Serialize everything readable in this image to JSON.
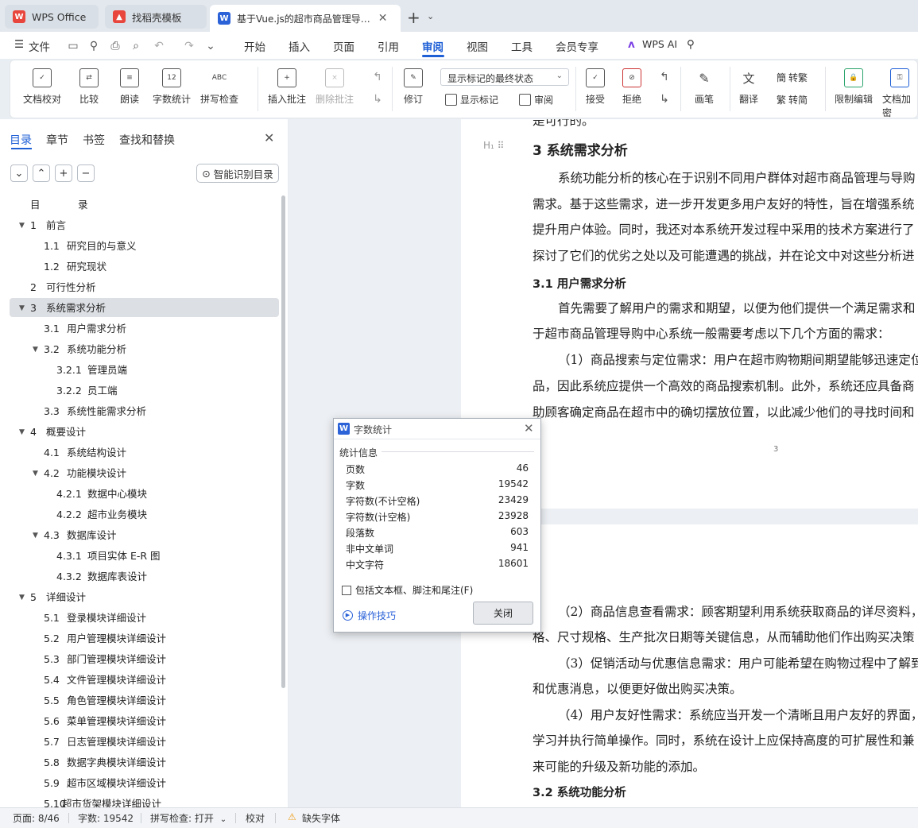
{
  "tabs": [
    {
      "label": "WPS Office",
      "icon": "wps-office-icon",
      "color": "#e8453c"
    },
    {
      "label": "找稻壳模板",
      "icon": "docer-template-icon",
      "color": "#e8453c"
    },
    {
      "label": "基于Vue.js的超市商品管理导…",
      "icon": "wps-writer-icon",
      "color": "#2b62d8"
    }
  ],
  "menubar": {
    "file": "文件",
    "items": [
      "开始",
      "插入",
      "页面",
      "引用",
      "审阅",
      "视图",
      "工具",
      "会员专享"
    ],
    "active": "审阅",
    "wps_ai": "WPS AI"
  },
  "ribbon": {
    "doc_proof": "文档校对",
    "compare": "比较",
    "read_aloud": "朗读",
    "word_count": "字数统计",
    "spell_check": "拼写检查",
    "insert_comment": "插入批注",
    "delete_comment": "删除批注",
    "revise": "修订",
    "display_dropdown": "显示标记的最终状态",
    "show_markup": "显示标记",
    "review": "审阅",
    "accept": "接受",
    "reject": "拒绝",
    "pen": "画笔",
    "translate": "翻译",
    "to_traditional": "转繁",
    "to_simplified": "转简",
    "restrict_edit": "限制编辑",
    "doc_encrypt": "文档加密",
    "word_count_icon_text": "12",
    "spell_icon_text": "ABC"
  },
  "leftpanel": {
    "tabs": [
      "目录",
      "章节",
      "书签",
      "查找和替换"
    ],
    "active_tab": "目录",
    "smart_button": "智能识别目录",
    "toc": [
      {
        "num": "目",
        "title": "录",
        "level": 0,
        "toggle": "",
        "highlight": false
      },
      {
        "num": "1",
        "title": "前言",
        "level": 1,
        "toggle": "▼",
        "highlight": false
      },
      {
        "num": "1.1",
        "title": "研究目的与意义",
        "level": 2,
        "toggle": "",
        "highlight": false
      },
      {
        "num": "1.2",
        "title": "研究现状",
        "level": 2,
        "toggle": "",
        "highlight": false
      },
      {
        "num": "2",
        "title": "可行性分析",
        "level": 1,
        "toggle": "",
        "highlight": false
      },
      {
        "num": "3",
        "title": "系统需求分析",
        "level": 1,
        "toggle": "▼",
        "highlight": true
      },
      {
        "num": "3.1",
        "title": "用户需求分析",
        "level": 2,
        "toggle": "",
        "highlight": false
      },
      {
        "num": "3.2",
        "title": "系统功能分析",
        "level": 2,
        "toggle": "▼",
        "highlight": false
      },
      {
        "num": "3.2.1",
        "title": "管理员端",
        "level": 3,
        "toggle": "",
        "highlight": false
      },
      {
        "num": "3.2.2",
        "title": "员工端",
        "level": 3,
        "toggle": "",
        "highlight": false
      },
      {
        "num": "3.3",
        "title": "系统性能需求分析",
        "level": 2,
        "toggle": "",
        "highlight": false
      },
      {
        "num": "4",
        "title": "概要设计",
        "level": 1,
        "toggle": "▼",
        "highlight": false
      },
      {
        "num": "4.1",
        "title": "系统结构设计",
        "level": 2,
        "toggle": "",
        "highlight": false
      },
      {
        "num": "4.2",
        "title": "功能模块设计",
        "level": 2,
        "toggle": "▼",
        "highlight": false
      },
      {
        "num": "4.2.1",
        "title": "数据中心模块",
        "level": 3,
        "toggle": "",
        "highlight": false
      },
      {
        "num": "4.2.2",
        "title": "超市业务模块",
        "level": 3,
        "toggle": "",
        "highlight": false
      },
      {
        "num": "4.3",
        "title": "数据库设计",
        "level": 2,
        "toggle": "▼",
        "highlight": false
      },
      {
        "num": "4.3.1",
        "title": "项目实体 E-R 图",
        "level": 3,
        "toggle": "",
        "highlight": false
      },
      {
        "num": "4.3.2",
        "title": "数据库表设计",
        "level": 3,
        "toggle": "",
        "highlight": false
      },
      {
        "num": "5",
        "title": "详细设计",
        "level": 1,
        "toggle": "▼",
        "highlight": false
      },
      {
        "num": "5.1",
        "title": "登录模块详细设计",
        "level": 2,
        "toggle": "",
        "highlight": false
      },
      {
        "num": "5.2",
        "title": "用户管理模块详细设计",
        "level": 2,
        "toggle": "",
        "highlight": false
      },
      {
        "num": "5.3",
        "title": "部门管理模块详细设计",
        "level": 2,
        "toggle": "",
        "highlight": false
      },
      {
        "num": "5.4",
        "title": "文件管理模块详细设计",
        "level": 2,
        "toggle": "",
        "highlight": false
      },
      {
        "num": "5.5",
        "title": "角色管理模块详细设计",
        "level": 2,
        "toggle": "",
        "highlight": false
      },
      {
        "num": "5.6",
        "title": "菜单管理模块详细设计",
        "level": 2,
        "toggle": "",
        "highlight": false
      },
      {
        "num": "5.7",
        "title": "日志管理模块详细设计",
        "level": 2,
        "toggle": "",
        "highlight": false
      },
      {
        "num": "5.8",
        "title": "数据字典模块详细设计",
        "level": 2,
        "toggle": "",
        "highlight": false
      },
      {
        "num": "5.9",
        "title": "超市区域模块详细设计",
        "level": 2,
        "toggle": "",
        "highlight": false
      },
      {
        "num": "5.10",
        "title": "超市货架模块详细设计",
        "level": 2,
        "toggle": "",
        "highlight": false
      }
    ]
  },
  "document": {
    "top_cut": "是可行的。",
    "heading3": "3    系统需求分析",
    "para1": [
      "系统功能分析的核心在于识别不同用户群体对超市商品管理与导购",
      "需求。基于这些需求，进一步开发更多用户友好的特性，旨在增强系统",
      "提升用户体验。同时，我还对本系统开发过程中采用的技术方案进行了",
      "探讨了它们的优劣之处以及可能遭遇的挑战，并在论文中对这些分析进"
    ],
    "heading31": "3.1    用户需求分析",
    "para2": [
      "首先需要了解用户的需求和期望，以便为他们提供一个满足需求和",
      "于超市商品管理导购中心系统一般需要考虑以下几个方面的需求："
    ],
    "para3": [
      "（1）商品搜索与定位需求：用户在超市购物期间期望能够迅速定位",
      "品，因此系统应提供一个高效的商品搜索机制。此外，系统还应具备商",
      "助顾客确定商品在超市中的确切摆放位置，以此减少他们的寻找时间和"
    ],
    "page_number": "3",
    "para4": [
      "（2）商品信息查看需求：顾客期望利用系统获取商品的详尽资料，",
      "格、尺寸规格、生产批次日期等关键信息，从而辅助他们作出购买决策"
    ],
    "para5": [
      "（3）促销活动与优惠信息需求：用户可能希望在购物过程中了解到",
      "和优惠消息，以便更好做出购买决策。"
    ],
    "para6": [
      "（4）用户友好性需求：系统应当开发一个清晰且用户友好的界面，",
      "学习并执行简单操作。同时，系统在设计上应保持高度的可扩展性和兼",
      "来可能的升级及新功能的添加。"
    ],
    "heading32": "3.2    系统功能分析"
  },
  "dialog": {
    "title": "字数统计",
    "section": "统计信息",
    "stats": [
      {
        "label": "页数",
        "value": "46"
      },
      {
        "label": "字数",
        "value": "19542"
      },
      {
        "label": "字符数(不计空格)",
        "value": "23429"
      },
      {
        "label": "字符数(计空格)",
        "value": "23928"
      },
      {
        "label": "段落数",
        "value": "603"
      },
      {
        "label": "非中文单词",
        "value": "941"
      },
      {
        "label": "中文字符",
        "value": "18601"
      }
    ],
    "checkbox_label": "包括文本框、脚注和尾注(F)",
    "tips": "操作技巧",
    "close": "关闭"
  },
  "statusbar": {
    "page": "页面: 8/46",
    "words": "字数: 19542",
    "spell": "拼写检查: 打开",
    "proof": "校对",
    "missing_font": "缺失字体"
  },
  "colors": {
    "accent": "#1e5fd6",
    "wps_red": "#e8453c",
    "warning": "#f0a020"
  }
}
